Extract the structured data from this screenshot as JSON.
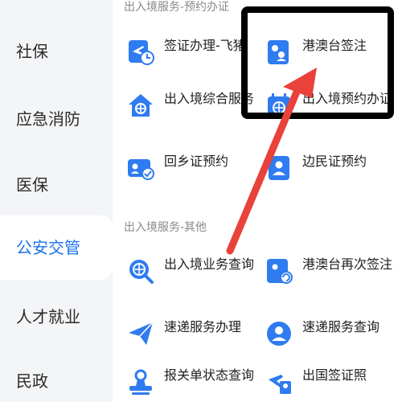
{
  "sidebar": {
    "items": [
      {
        "label": "社保",
        "active": false
      },
      {
        "label": "应急消防",
        "active": false
      },
      {
        "label": "医保",
        "active": false
      },
      {
        "label": "公安交管",
        "active": true
      },
      {
        "label": "人才就业",
        "active": false
      },
      {
        "label": "民政",
        "active": false
      }
    ]
  },
  "sections": [
    {
      "title": "出入境服务-预约办证",
      "services": [
        {
          "label": "签证办理-飞猪",
          "icon": "plane-clock-icon"
        },
        {
          "label": "港澳台签注",
          "icon": "passport-person-icon"
        },
        {
          "label": "出入境综合服务",
          "icon": "house-globe-icon"
        },
        {
          "label": "出入境预约办证",
          "icon": "calendar-globe-icon"
        },
        {
          "label": "回乡证预约",
          "icon": "id-card-check-icon"
        },
        {
          "label": "边民证预约",
          "icon": "id-card-person-icon"
        }
      ]
    },
    {
      "title": "出入境服务-其他",
      "services": [
        {
          "label": "出入境业务查询",
          "icon": "globe-search-icon"
        },
        {
          "label": "港澳台再次签注",
          "icon": "passport-refresh-icon"
        },
        {
          "label": "速递服务办理",
          "icon": "paper-plane-icon"
        },
        {
          "label": "速递服务查询",
          "icon": "person-search-icon"
        },
        {
          "label": "报关单状态查询",
          "icon": "stamp-icon"
        },
        {
          "label": "出国签证照",
          "icon": "plane-photo-icon"
        }
      ]
    }
  ],
  "colors": {
    "accent": "#1a73e8",
    "sidebar_bg": "#f4f5f7",
    "overlay_arrow": "#e8423a",
    "overlay_box": "#000000"
  }
}
